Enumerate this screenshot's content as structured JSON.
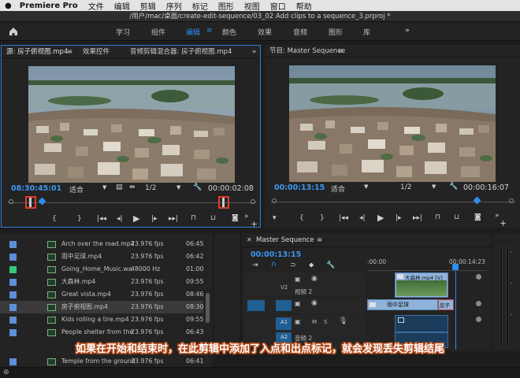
{
  "menubar": {
    "app_name": "Premiere Pro",
    "items": [
      "文件",
      "编辑",
      "剪辑",
      "序列",
      "标记",
      "图形",
      "视图",
      "窗口",
      "帮助"
    ]
  },
  "window": {
    "title": "/用户/mac/桌面/create-edit-sequence/03_02 Add clips to a sequence_3.prproj *"
  },
  "workspaces": {
    "tabs": [
      "学习",
      "组件",
      "编辑",
      "颜色",
      "效果",
      "音频",
      "图形",
      "库"
    ],
    "active": "编辑",
    "more": "»"
  },
  "source_panel": {
    "tabs": [
      "源: 房子俯视图.mp4",
      "效果控件",
      "音频剪辑混合器: 房子俯视图.mp4"
    ],
    "timecode_current": "08:30:45:01",
    "fit": "适合",
    "resolution": "1/2",
    "duration": "00:00:02:08"
  },
  "program_panel": {
    "title": "节目: Master Sequence",
    "timecode_current": "00:00:13:15",
    "fit": "适合",
    "resolution": "1/2",
    "duration": "00:00:16:07"
  },
  "project_items": [
    {
      "name": "Arch over the road.mp4",
      "fps": "23.976 fps",
      "pos": "06:45",
      "color": "#5d8ed6"
    },
    {
      "name": "雨中足球.mp4",
      "fps": "23.976 fps",
      "pos": "06:42",
      "color": "#5d8ed6"
    },
    {
      "name": "Going_Home_Music.wa",
      "fps": "48000 Hz",
      "pos": "01:00",
      "color": "#35c67a"
    },
    {
      "name": "大森林.mp4",
      "fps": "23.976 fps",
      "pos": "09:55",
      "color": "#5d8ed6"
    },
    {
      "name": "Great vista.mp4",
      "fps": "23.976 fps",
      "pos": "08:46",
      "color": "#5d8ed6"
    },
    {
      "name": "房子俯视图.mp4",
      "fps": "23.976 fps",
      "pos": "08:30",
      "color": "#5d8ed6"
    },
    {
      "name": "Kids rolling a tire.mp4",
      "fps": "23.976 fps",
      "pos": "09:55",
      "color": "#5d8ed6"
    },
    {
      "name": "People shelter from the",
      "fps": "23.976 fps",
      "pos": "06:43",
      "color": "#5d8ed6"
    },
    {
      "name": "Temple from the ground",
      "fps": "23.976 fps",
      "pos": "06:41",
      "color": "#5d8ed6"
    }
  ],
  "timeline": {
    "title": "Master Sequence",
    "timecode": "00:00:13:15",
    "ruler_start": ":00:00",
    "ruler_end": "00:00:14:23",
    "tracks": [
      {
        "id": "V2",
        "label": "视频 2"
      },
      {
        "id": "V1",
        "label": ""
      },
      {
        "id": "A1",
        "label": ""
      },
      {
        "id": "A2",
        "label": "音频 2"
      }
    ],
    "clips": [
      {
        "label": "大森林.mp4 [V]",
        "track": "V2"
      },
      {
        "label": "雨中足球",
        "track": "V1"
      },
      {
        "label": "房子",
        "track": "V1"
      }
    ]
  },
  "caption": "如果在开始和结束时，在此剪辑中添加了入点和出点标记，就会发现丢失剪辑结尾"
}
